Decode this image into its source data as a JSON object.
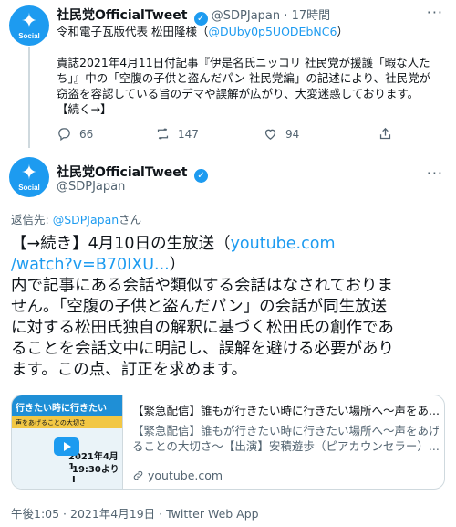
{
  "tweet1": {
    "display_name": "社民党OfficialTweet",
    "handle": "@SDPJapan",
    "separator": "·",
    "time_ago": "17時間",
    "avatar_text": "Social",
    "line1_prefix": "令和電子瓦版代表 松田隆様（",
    "line1_link": "@DUby0p5UODEbNC6",
    "line1_suffix": "）",
    "lines": [
      "貴誌2021年4月11日付記事『伊是名氏ニッコリ 社民党が援護「暇な人た",
      "ち」』中の「空腹の子供と盗んだパン 社民党編」の記述により、社民党が",
      "窃盗を容認している旨のデマや誤解が広がり、大変迷惑しております。",
      "【続く→】"
    ],
    "reply_count": "66",
    "retweet_count": "147",
    "like_count": "94"
  },
  "tweet2": {
    "display_name": "社民党OfficialTweet",
    "handle": "@SDPJapan",
    "avatar_text": "Social",
    "more": "···",
    "reply_prefix": "返信先: ",
    "reply_to": "@SDPJapan",
    "reply_suffix": "さん",
    "body_line1_text": "【→続き】4月10日の生放送（",
    "body_line1_link": "youtube.com",
    "body_line2_link": "/watch?v=B70IXU...",
    "body_line2_text": "）",
    "body_lines": [
      "内で記事にある会話や類似する会話はなされておりま",
      "せん。「空腹の子供と盗んだパン」の会話が同生放送",
      "に対する松田氏独自の解釈に基づく松田氏の創作であ",
      "ることを会話文中に明記し、誤解を避ける必要があり",
      "ます。この点、訂正を求めます。"
    ],
    "card": {
      "title": "【緊急配信】誰もが行きたい時に行きたい場所へ〜声をあ...",
      "desc_line1": "【緊急配信】誰もが行きたい時に行きたい場所へ〜声をあげ",
      "desc_line2": "ることの大切さ〜【出演】安積遊歩（ピアカウンセラー）...",
      "domain": "youtube.com",
      "thumb_banner": "行きたい時に行きたい",
      "thumb_sub": "声をあげることの大切さ",
      "thumb_date": "2021年4月1",
      "thumb_time": "19:30よりI"
    },
    "footer": "午後1:05 · 2021年4月19日 · Twitter Web App"
  },
  "colors": {
    "accent": "#1d9bf0",
    "text": "#0f1419",
    "muted": "#536471",
    "border": "#cfd9de"
  }
}
